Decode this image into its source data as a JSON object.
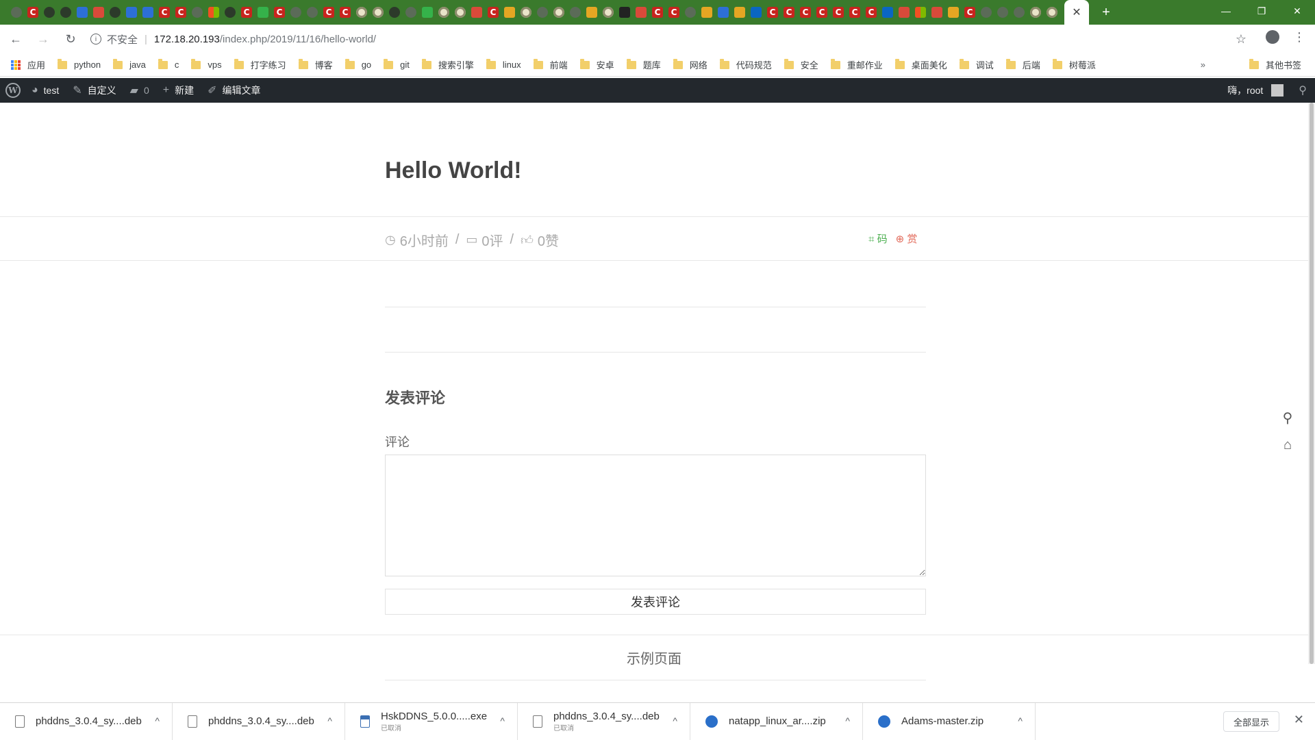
{
  "browser": {
    "active_tab_close": "✕",
    "new_tab": "+",
    "window_controls": {
      "minimize": "—",
      "restore": "❐",
      "close": "✕"
    },
    "tab_favicons": [
      "gray",
      "c",
      "dark",
      "dark",
      "blue",
      "red",
      "dark",
      "blue",
      "blue",
      "c",
      "c",
      "gray",
      "multi",
      "dark",
      "c",
      "green",
      "c",
      "gray",
      "gray",
      "c",
      "c",
      "ring",
      "ring",
      "dark",
      "gray",
      "green",
      "ring",
      "ring",
      "red",
      "c",
      "yellow",
      "ring",
      "gray",
      "ring",
      "gray",
      "yellow",
      "ring",
      "bt",
      "red",
      "c",
      "c",
      "gray",
      "yellow",
      "blue",
      "yellow",
      "zhi",
      "c",
      "c",
      "c",
      "c",
      "c",
      "c",
      "c",
      "zhi",
      "red",
      "multi",
      "red",
      "yellow",
      "c",
      "gray",
      "gray",
      "gray",
      "ring",
      "ring"
    ],
    "address": {
      "security_label": "不安全",
      "host": "172.18.20.193",
      "path": "/index.php/2019/11/16/hello-world/"
    },
    "bookmarks": [
      {
        "label": "应用",
        "type": "apps"
      },
      {
        "label": "python",
        "type": "folder"
      },
      {
        "label": "java",
        "type": "folder"
      },
      {
        "label": "c",
        "type": "folder"
      },
      {
        "label": "vps",
        "type": "folder"
      },
      {
        "label": "打字练习",
        "type": "folder"
      },
      {
        "label": "博客",
        "type": "folder"
      },
      {
        "label": "go",
        "type": "folder"
      },
      {
        "label": "git",
        "type": "folder"
      },
      {
        "label": "搜索引擎",
        "type": "folder"
      },
      {
        "label": "linux",
        "type": "folder"
      },
      {
        "label": "前端",
        "type": "folder"
      },
      {
        "label": "安卓",
        "type": "folder"
      },
      {
        "label": "题库",
        "type": "folder"
      },
      {
        "label": "网络",
        "type": "folder"
      },
      {
        "label": "代码规范",
        "type": "folder"
      },
      {
        "label": "安全",
        "type": "folder"
      },
      {
        "label": "重邮作业",
        "type": "folder"
      },
      {
        "label": "桌面美化",
        "type": "folder"
      },
      {
        "label": "调试",
        "type": "folder"
      },
      {
        "label": "后端",
        "type": "folder"
      },
      {
        "label": "树莓派",
        "type": "folder"
      }
    ],
    "bookmarks_more": "»",
    "other_bookmarks": "其他书签"
  },
  "adminbar": {
    "site_name": "test",
    "customize": "自定义",
    "comments_count": "0",
    "new": "新建",
    "edit_post": "编辑文章",
    "greeting": "嗨，root"
  },
  "post": {
    "title": "Hello World!",
    "time_ago": "6小时前",
    "comments": "0评",
    "likes": "0赞",
    "qr_label": "码",
    "reward_label": "赏"
  },
  "comment_form": {
    "heading": "发表评论",
    "label": "评论",
    "textarea_value": "",
    "submit": "发表评论"
  },
  "footer_link": "示例页面",
  "downloads": [
    {
      "name": "phddns_3.0.4_sy....deb",
      "status": "",
      "icon": "file"
    },
    {
      "name": "phddns_3.0.4_sy....deb",
      "status": "",
      "icon": "file"
    },
    {
      "name": "HskDDNS_5.0.0.....exe",
      "status": "已取消",
      "icon": "exe"
    },
    {
      "name": "phddns_3.0.4_sy....deb",
      "status": "已取消",
      "icon": "file"
    },
    {
      "name": "natapp_linux_ar....zip",
      "status": "",
      "icon": "zip"
    },
    {
      "name": "Adams-master.zip",
      "status": "",
      "icon": "zip"
    }
  ],
  "downloads_show_all": "全部显示",
  "colors": {
    "tabstrip": "#3a7a2c",
    "adminbar": "#23282d",
    "qr": "#4caf50",
    "reward": "#e26a5a"
  }
}
